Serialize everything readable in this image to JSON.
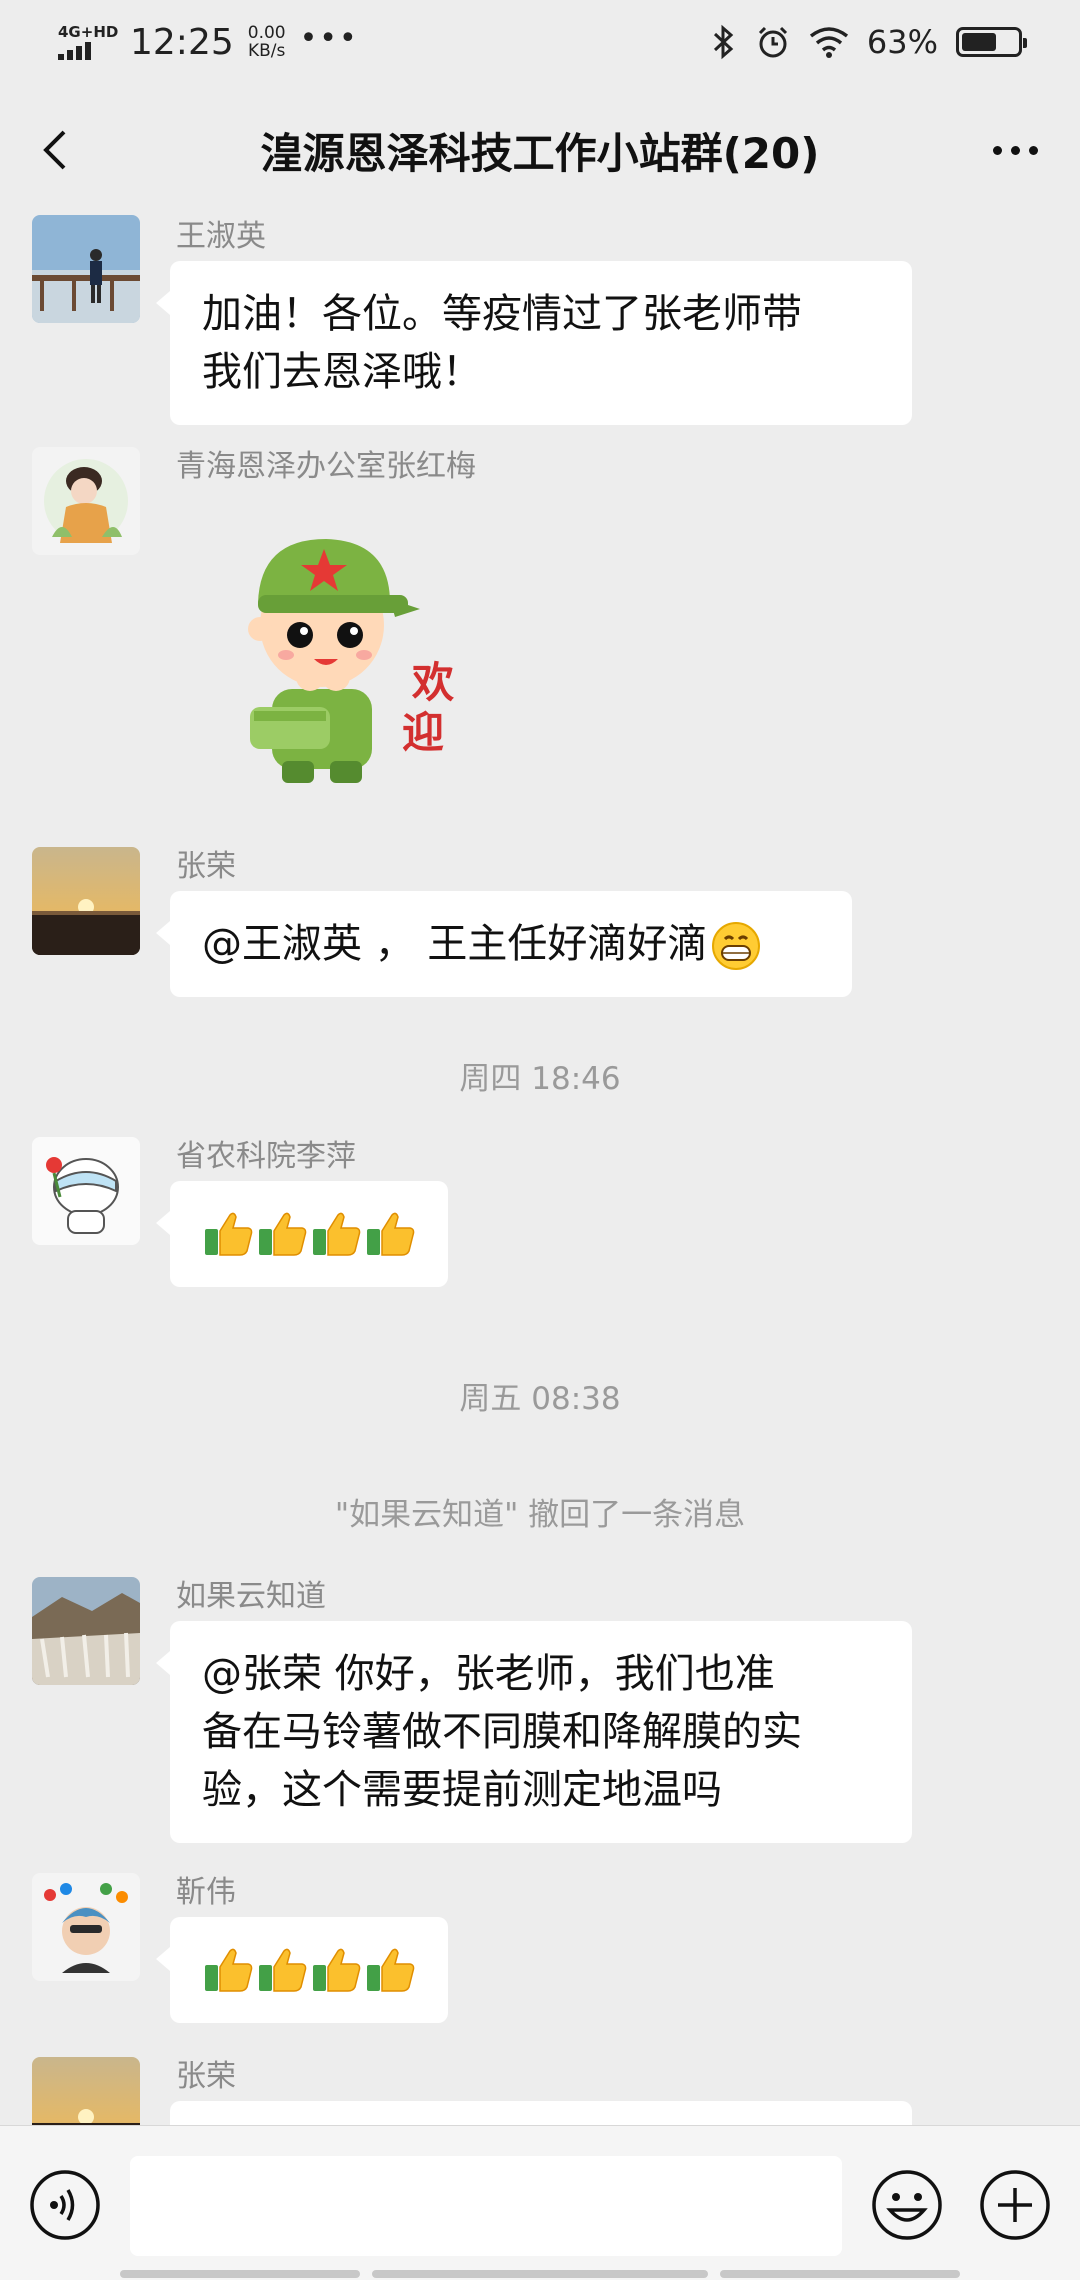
{
  "status_bar": {
    "network": "4G+HD",
    "time": "12:25",
    "speed_value": "0.00",
    "speed_unit": "KB/s",
    "more": "•••",
    "battery_percent": "63%",
    "battery_level": 0.63
  },
  "header": {
    "title": "湟源恩泽科技工作小站群(20)"
  },
  "messages": [
    {
      "sender": "王淑英",
      "lines": [
        "加油！各位。等疫情过了张老师带",
        "我们去恩泽哦！"
      ]
    },
    {
      "sender": "青海恩泽办公室张红梅",
      "sticker_text": [
        "欢",
        "迎"
      ]
    },
    {
      "sender": "张荣",
      "text": "@王淑英 ， 王主任好滴好滴",
      "emoji": "grinning-face-icon"
    },
    {
      "sender": "省农科院李萍",
      "thumbs_count": 4
    },
    {
      "sender": "如果云知道",
      "lines": [
        "@张荣  你好，张老师，我们也准",
        "备在马铃薯做不同膜和降解膜的实",
        "验，这个需要提前测定地温吗"
      ]
    },
    {
      "sender": "靳伟",
      "thumbs_count": 4
    },
    {
      "sender": "张荣"
    }
  ],
  "timestamps": {
    "t1": "周四 18:46",
    "t2": "周五 08:38"
  },
  "system_notice": "\"如果云知道\" 撤回了一条消息",
  "input_bar": {
    "placeholder": ""
  },
  "colors": {
    "background": "#ededed",
    "bubble": "#ffffff",
    "meta_text": "#8a8a8a"
  }
}
